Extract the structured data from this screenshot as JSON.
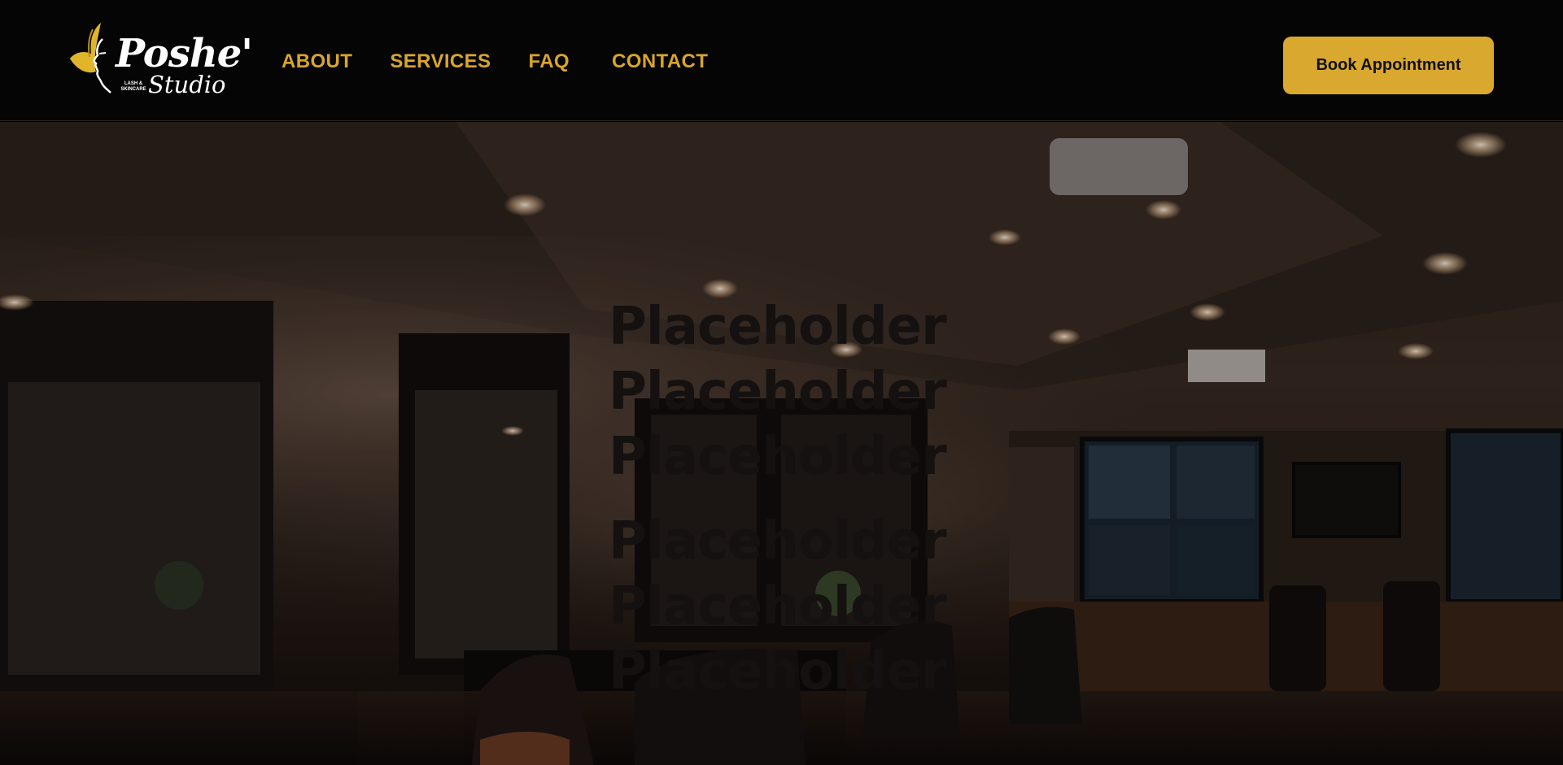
{
  "brand": {
    "name": "Poshe'",
    "sub": "Studio",
    "tagline_line1": "LASH &",
    "tagline_line2": "SKINCARE"
  },
  "nav": {
    "items": [
      "ABOUT",
      "SERVICES",
      "FAQ",
      "CONTACT"
    ]
  },
  "cta": {
    "label": "Book Appointment"
  },
  "hero": {
    "headline_lines": [
      "Placeholder",
      "Placeholder",
      "Placeholder",
      "Placeholder",
      "Placeholder",
      "Placeholder"
    ]
  },
  "colors": {
    "nav_text": "#d9a52e",
    "button_bg": "#d9a82e",
    "header_bg": "#050505",
    "headline": "#141110"
  },
  "icons": [
    "butterfly-wing-logo-icon",
    "face-profile-logo-icon"
  ]
}
